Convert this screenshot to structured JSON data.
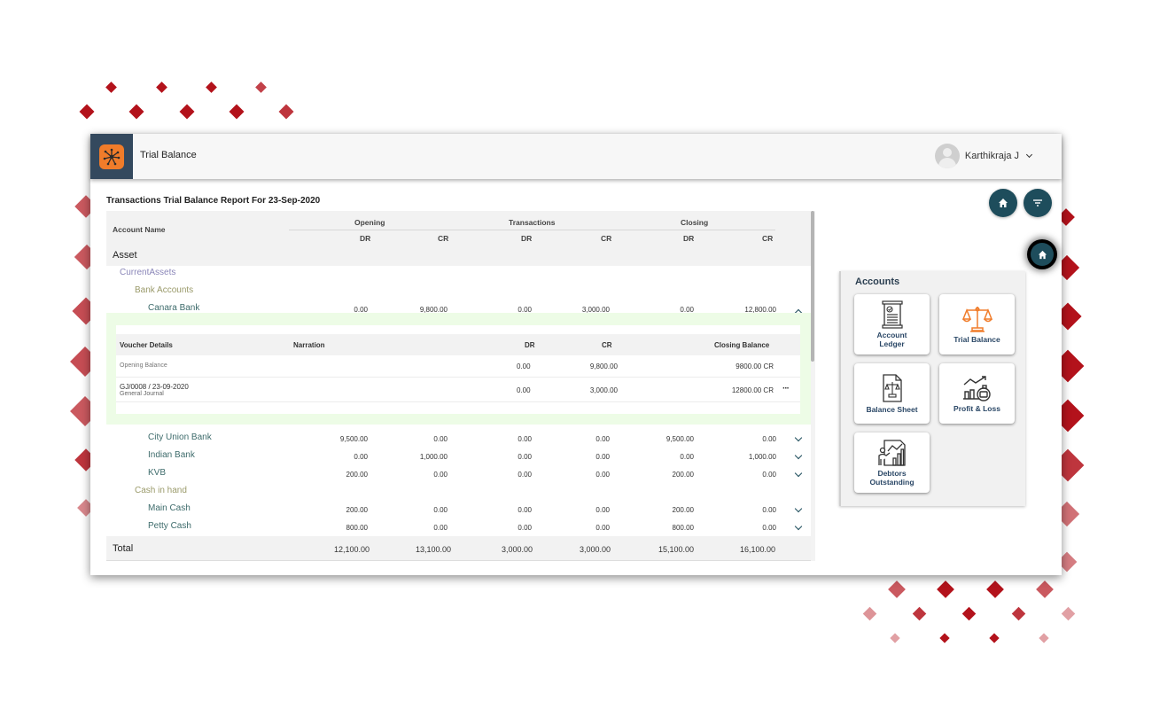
{
  "app": {
    "title": "Trial Balance",
    "user_name": "Karthikraja J"
  },
  "report": {
    "title": "Transactions Trial Balance Report For 23-Sep-2020",
    "columns": {
      "account_name": "Account Name",
      "groups": [
        "Opening",
        "Transactions",
        "Closing"
      ],
      "sub": [
        "DR",
        "CR",
        "DR",
        "CR",
        "DR",
        "CR"
      ]
    },
    "tree": {
      "asset": "Asset",
      "current_assets": "CurrentAssets",
      "bank_accounts": "Bank Accounts",
      "cash_in_hand": "Cash in hand"
    },
    "rows": [
      {
        "name": "Canara Bank",
        "values": [
          "0.00",
          "9,800.00",
          "0.00",
          "3,000.00",
          "0.00",
          "12,800.00"
        ],
        "expanded": true
      },
      {
        "name": "City Union Bank",
        "values": [
          "9,500.00",
          "0.00",
          "0.00",
          "0.00",
          "9,500.00",
          "0.00"
        ],
        "expanded": false
      },
      {
        "name": "Indian Bank",
        "values": [
          "0.00",
          "1,000.00",
          "0.00",
          "0.00",
          "0.00",
          "1,000.00"
        ],
        "expanded": false
      },
      {
        "name": "KVB",
        "values": [
          "200.00",
          "0.00",
          "0.00",
          "0.00",
          "200.00",
          "0.00"
        ],
        "expanded": false
      },
      {
        "name": "Main Cash",
        "values": [
          "200.00",
          "0.00",
          "0.00",
          "0.00",
          "200.00",
          "0.00"
        ],
        "expanded": false
      },
      {
        "name": "Petty Cash",
        "values": [
          "800.00",
          "0.00",
          "0.00",
          "0.00",
          "800.00",
          "0.00"
        ],
        "expanded": false
      }
    ],
    "total": {
      "label": "Total",
      "values": [
        "12,100.00",
        "13,100.00",
        "3,000.00",
        "3,000.00",
        "15,100.00",
        "16,100.00"
      ]
    },
    "voucher_details": {
      "headers": [
        "Voucher Details",
        "Narration",
        "DR",
        "CR",
        "Closing Balance"
      ],
      "rows": [
        {
          "voucher": "Opening Balance",
          "sub": "",
          "narration": "",
          "dr": "0.00",
          "cr": "9,800.00",
          "closing": "9800.00 CR",
          "more": false
        },
        {
          "voucher": "GJ/0008 / 23-09-2020",
          "sub": "General Journal",
          "narration": "",
          "dr": "0.00",
          "cr": "3,000.00",
          "closing": "12800.00 CR",
          "more": true
        }
      ]
    }
  },
  "panel": {
    "title": "Accounts",
    "tiles": [
      {
        "label_1": "Account",
        "label_2": "Ledger",
        "icon": "ledger-icon"
      },
      {
        "label_1": "Trial Balance",
        "label_2": "",
        "icon": "scales-icon"
      },
      {
        "label_1": "Balance Sheet",
        "label_2": "",
        "icon": "balance-sheet-icon"
      },
      {
        "label_1": "Profit & Loss",
        "label_2": "",
        "icon": "profit-loss-icon"
      },
      {
        "label_1": "Debtors",
        "label_2": "Outstanding",
        "icon": "debtors-icon"
      }
    ]
  },
  "colors": {
    "header_dark": "#34495e",
    "logo_orange": "#f07c2a",
    "fab_teal": "#1e4d5c",
    "expanded_bg": "#edfce6",
    "diamond_red": "#b3121b"
  }
}
